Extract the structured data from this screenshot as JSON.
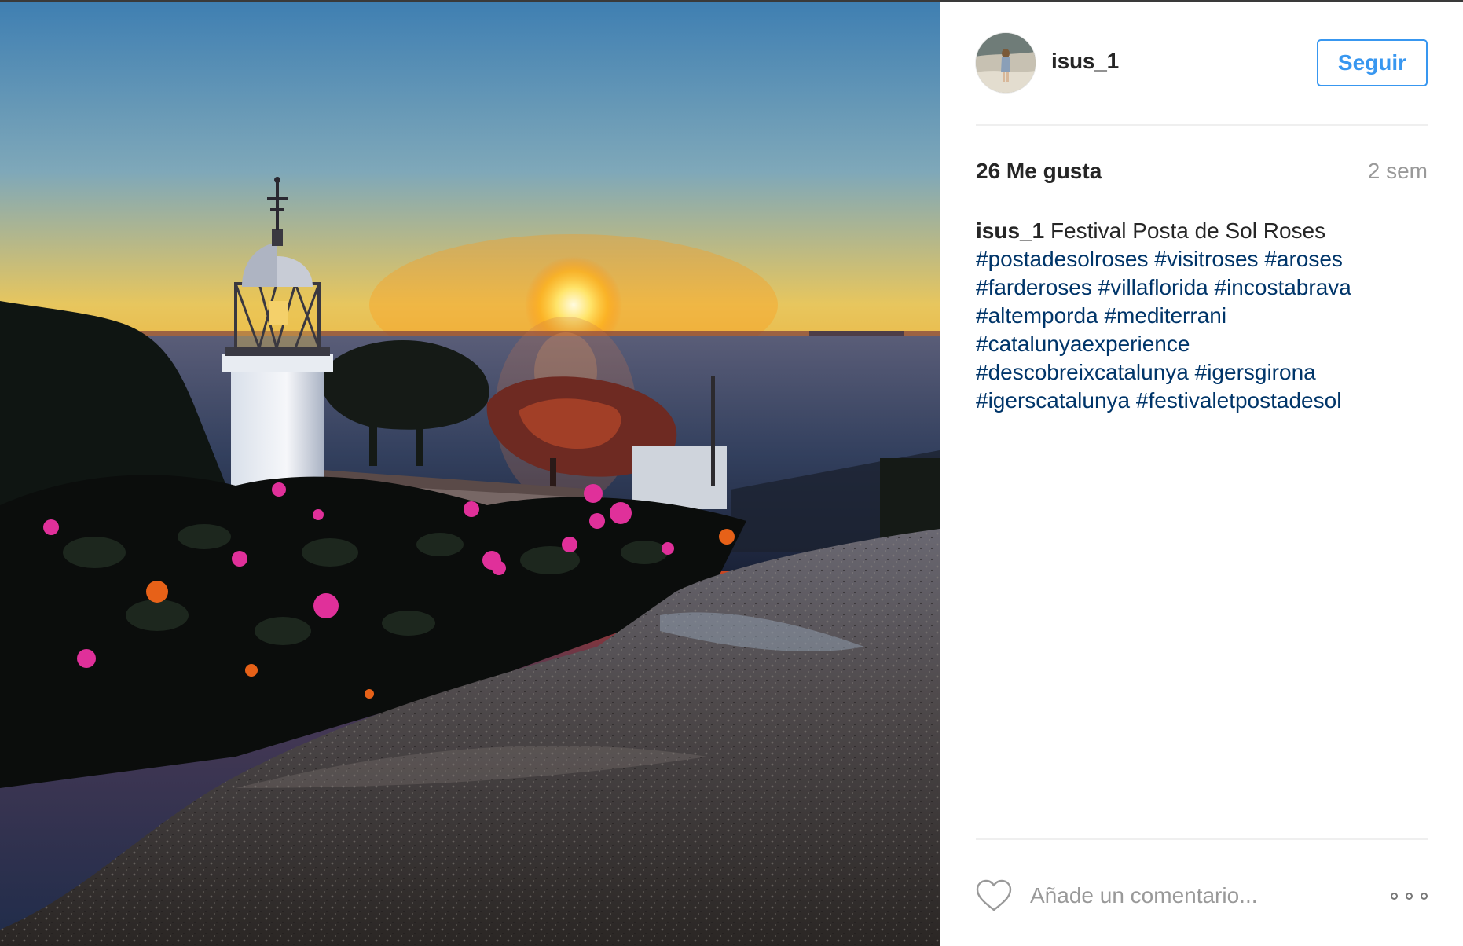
{
  "post": {
    "image_alt": "Sunset over the Mediterranean with lighthouse and bougainvillea"
  },
  "author": {
    "username": "isus_1",
    "avatar_icon": "avatar-photo"
  },
  "header": {
    "follow_label": "Seguir"
  },
  "stats": {
    "likes": "26 Me gusta",
    "posted_ago": "2 sem"
  },
  "caption": {
    "username": "isus_1",
    "text": "Festival Posta de Sol Roses",
    "hashtags": [
      "#postadesolroses",
      "#visitroses",
      "#aroses",
      "#farderoses",
      "#villaflorida",
      "#incostabrava",
      "#altemporda",
      "#mediterrani",
      "#catalunyaexperience",
      "#descobreixcatalunya",
      "#igersgirona",
      "#igerscatalunya",
      "#festivaletpostadesol"
    ]
  },
  "footer": {
    "like_icon": "heart-icon",
    "comment_placeholder": "Añade un comentario...",
    "more_icon": "more-options-icon"
  },
  "colors": {
    "accent": "#3897f0",
    "hashtag": "#003569",
    "text": "#262626",
    "muted": "#999999"
  }
}
